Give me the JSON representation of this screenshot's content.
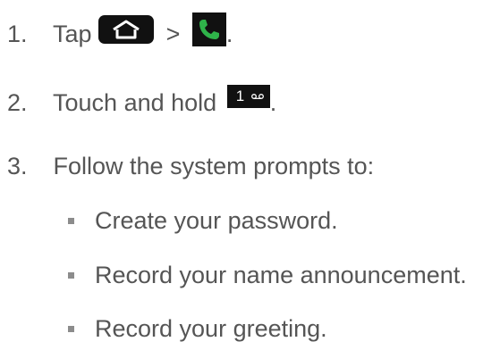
{
  "steps": [
    {
      "number": "1.",
      "text": "Tap",
      "separator": ">",
      "end": "."
    },
    {
      "number": "2.",
      "text": "Touch and hold",
      "end": "."
    },
    {
      "number": "3.",
      "text": "Follow the system prompts to:"
    }
  ],
  "bullets": [
    "Create your password.",
    "Record your name announcement.",
    "Record your greeting."
  ],
  "icons": {
    "home": "home-icon",
    "phone": "phone-icon",
    "voicemail": "voicemail-icon"
  },
  "key": {
    "digit": "1"
  },
  "colors": {
    "text": "#555555",
    "icon_bg": "#111111",
    "phone_green": "#2fb34a",
    "bullet": "#8c8c8c"
  }
}
